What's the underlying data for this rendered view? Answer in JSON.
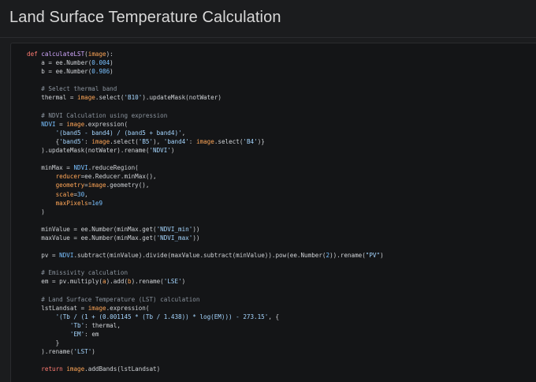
{
  "page": {
    "title": "Land Surface Temperature Calculation"
  },
  "theme": {
    "background": "#1b1c1e",
    "code_background": "#141517",
    "keyword": "#ff7b72",
    "function": "#d2a8ff",
    "variable": "#79c0ff",
    "string": "#a5d6ff",
    "comment": "#8b949e",
    "argument": "#ffa657",
    "text": "#cfd2d6"
  },
  "code": {
    "language": "python",
    "lines": [
      [
        [
          "kw",
          "def "
        ],
        [
          "fn",
          "calculateLST"
        ],
        [
          "plain",
          "("
        ],
        [
          "arg",
          "image"
        ],
        [
          "plain",
          "):"
        ]
      ],
      [
        [
          "plain",
          "    a = "
        ],
        [
          "plain",
          "ee.Number("
        ],
        [
          "num",
          "0.004"
        ],
        [
          "plain",
          ")"
        ]
      ],
      [
        [
          "plain",
          "    b = "
        ],
        [
          "plain",
          "ee.Number("
        ],
        [
          "num",
          "0.986"
        ],
        [
          "plain",
          ")"
        ]
      ],
      [
        [
          "plain",
          ""
        ]
      ],
      [
        [
          "com",
          "    # Select thermal band"
        ]
      ],
      [
        [
          "plain",
          "    thermal = "
        ],
        [
          "arg",
          "image"
        ],
        [
          "plain",
          ".select("
        ],
        [
          "str",
          "'B10'"
        ],
        [
          "plain",
          ").updateMask(notWater)"
        ]
      ],
      [
        [
          "plain",
          ""
        ]
      ],
      [
        [
          "com",
          "    # NDVI Calculation using expression"
        ]
      ],
      [
        [
          "plain",
          "    "
        ],
        [
          "var",
          "NDVI"
        ],
        [
          "plain",
          " = "
        ],
        [
          "arg",
          "image"
        ],
        [
          "plain",
          ".expression("
        ]
      ],
      [
        [
          "plain",
          "        "
        ],
        [
          "str",
          "'(band5 - band4) / (band5 + band4)'"
        ],
        [
          "plain",
          ","
        ]
      ],
      [
        [
          "plain",
          "        {"
        ],
        [
          "str",
          "'band5'"
        ],
        [
          "plain",
          ": "
        ],
        [
          "arg",
          "image"
        ],
        [
          "plain",
          ".select("
        ],
        [
          "str",
          "'B5'"
        ],
        [
          "plain",
          "), "
        ],
        [
          "str",
          "'band4'"
        ],
        [
          "plain",
          ": "
        ],
        [
          "arg",
          "image"
        ],
        [
          "plain",
          ".select("
        ],
        [
          "str",
          "'B4'"
        ],
        [
          "plain",
          ")}"
        ]
      ],
      [
        [
          "plain",
          "    ).updateMask(notWater).rename("
        ],
        [
          "str",
          "'NDVI'"
        ],
        [
          "plain",
          ")"
        ]
      ],
      [
        [
          "plain",
          ""
        ]
      ],
      [
        [
          "plain",
          "    minMax = "
        ],
        [
          "var",
          "NDVI"
        ],
        [
          "plain",
          ".reduceRegion("
        ]
      ],
      [
        [
          "plain",
          "        "
        ],
        [
          "arg",
          "reducer"
        ],
        [
          "plain",
          "=ee.Reducer.minMax(),"
        ]
      ],
      [
        [
          "plain",
          "        "
        ],
        [
          "arg",
          "geometry"
        ],
        [
          "plain",
          "="
        ],
        [
          "arg",
          "image"
        ],
        [
          "plain",
          ".geometry(),"
        ]
      ],
      [
        [
          "plain",
          "        "
        ],
        [
          "arg",
          "scale"
        ],
        [
          "plain",
          "="
        ],
        [
          "num",
          "30"
        ],
        [
          "plain",
          ","
        ]
      ],
      [
        [
          "plain",
          "        "
        ],
        [
          "arg",
          "maxPixels"
        ],
        [
          "plain",
          "="
        ],
        [
          "num",
          "1e9"
        ]
      ],
      [
        [
          "plain",
          "    )"
        ]
      ],
      [
        [
          "plain",
          ""
        ]
      ],
      [
        [
          "plain",
          "    minValue = ee.Number(minMax.get("
        ],
        [
          "str",
          "'NDVI_min'"
        ],
        [
          "plain",
          "))"
        ]
      ],
      [
        [
          "plain",
          "    maxValue = ee.Number(minMax.get("
        ],
        [
          "str",
          "'NDVI_max'"
        ],
        [
          "plain",
          "))"
        ]
      ],
      [
        [
          "plain",
          ""
        ]
      ],
      [
        [
          "plain",
          "    pv = "
        ],
        [
          "var",
          "NDVI"
        ],
        [
          "plain",
          ".subtract(minValue).divide(maxValue.subtract(minValue)).pow(ee.Number("
        ],
        [
          "num",
          "2"
        ],
        [
          "plain",
          ")).rename("
        ],
        [
          "str",
          "\"PV\""
        ],
        [
          "plain",
          ")"
        ]
      ],
      [
        [
          "plain",
          ""
        ]
      ],
      [
        [
          "com",
          "    # Emissivity calculation"
        ]
      ],
      [
        [
          "plain",
          "    em = pv.multiply("
        ],
        [
          "arg",
          "a"
        ],
        [
          "plain",
          ").add("
        ],
        [
          "arg",
          "b"
        ],
        [
          "plain",
          ").rename("
        ],
        [
          "str",
          "'LSE'"
        ],
        [
          "plain",
          ")"
        ]
      ],
      [
        [
          "plain",
          ""
        ]
      ],
      [
        [
          "com",
          "    # Land Surface Temperature (LST) calculation"
        ]
      ],
      [
        [
          "plain",
          "    lstLandsat = "
        ],
        [
          "arg",
          "image"
        ],
        [
          "plain",
          ".expression("
        ]
      ],
      [
        [
          "plain",
          "        "
        ],
        [
          "str",
          "'(Tb / (1 + (0.001145 * (Tb / 1.438)) * log(EM))) - 273.15'"
        ],
        [
          "plain",
          ", {"
        ]
      ],
      [
        [
          "plain",
          "            "
        ],
        [
          "str",
          "'Tb'"
        ],
        [
          "plain",
          ": thermal,"
        ]
      ],
      [
        [
          "plain",
          "            "
        ],
        [
          "str",
          "'EM'"
        ],
        [
          "plain",
          ": em"
        ]
      ],
      [
        [
          "plain",
          "        }"
        ]
      ],
      [
        [
          "plain",
          "    ).rename("
        ],
        [
          "str",
          "'LST'"
        ],
        [
          "plain",
          ")"
        ]
      ],
      [
        [
          "plain",
          ""
        ]
      ],
      [
        [
          "plain",
          "    "
        ],
        [
          "kw",
          "return "
        ],
        [
          "arg",
          "image"
        ],
        [
          "plain",
          ".addBands(lstLandsat)"
        ]
      ]
    ]
  }
}
